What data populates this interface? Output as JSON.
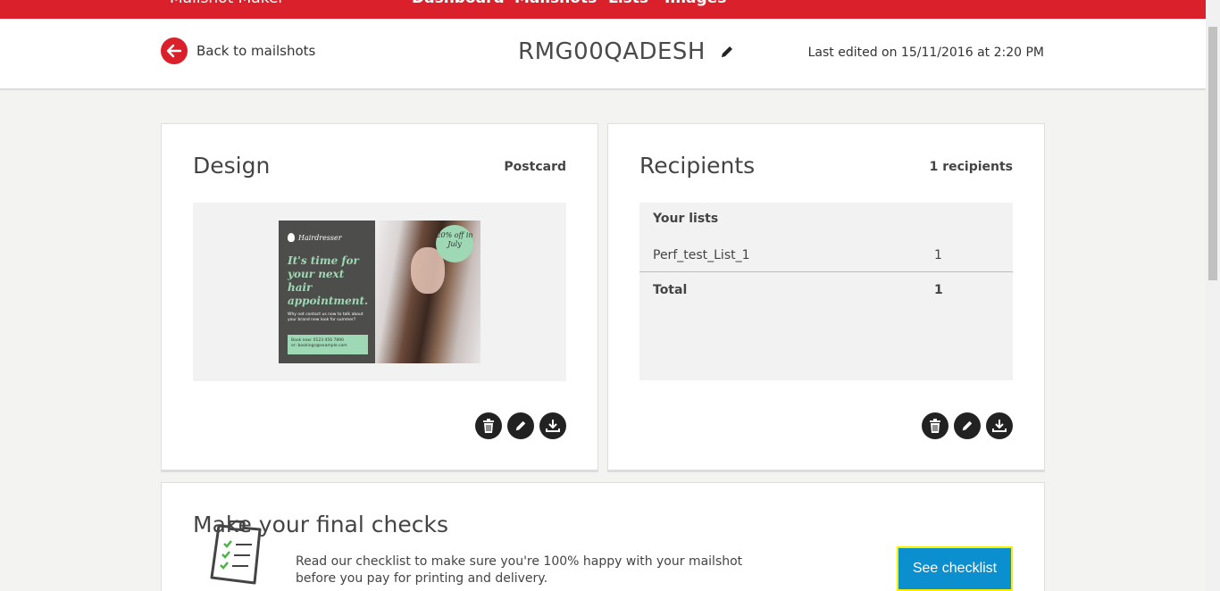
{
  "topnav": {
    "brand": "Mailshot Maker",
    "links": [
      "Dashboard",
      "Mailshots",
      "Lists",
      "Images"
    ],
    "color": "#da202a"
  },
  "header": {
    "back_label": "Back to mailshots",
    "title": "RMG00QADESH",
    "last_edited": "Last edited on 15/11/2016 at 2:20 PM"
  },
  "design": {
    "heading": "Design",
    "type": "Postcard",
    "postcard": {
      "brand": "Hairdresser",
      "headline": "It's time for your next hair appointment.",
      "body": "Why not contact us now to talk about your brand new look for summer?",
      "contact_line1": "Book now: 0123 456 7890",
      "contact_line2": "or: bookings@example.com",
      "badge": "20% off in July"
    }
  },
  "recipients": {
    "heading": "Recipients",
    "count_label": "1 recipients",
    "lists_header": "Your lists",
    "rows": [
      {
        "name": "Perf_test_List_1",
        "count": "1"
      }
    ],
    "total_label": "Total",
    "total_count": "1"
  },
  "checks": {
    "title": "Make your final checks",
    "text": "Read our checklist to make sure you're 100% happy with your mailshot before you pay for printing and delivery.",
    "button": "See checklist"
  }
}
